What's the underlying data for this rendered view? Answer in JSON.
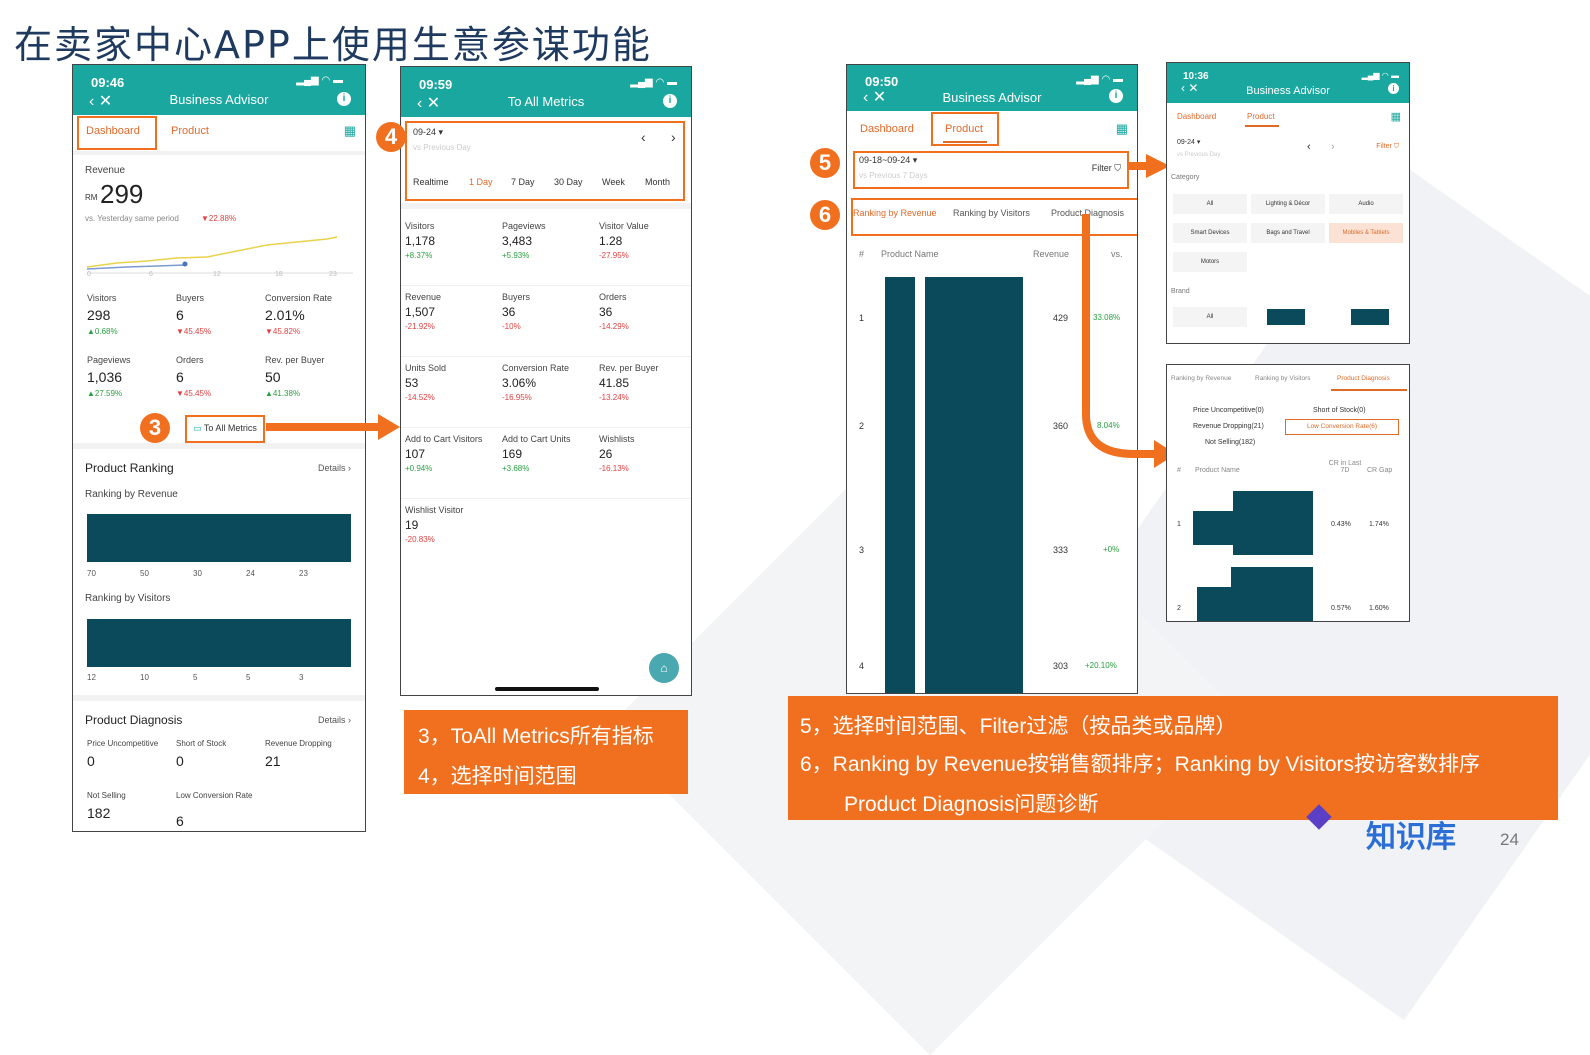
{
  "title": "在卖家中心APP上使用生意参谋功能",
  "page_number": "24",
  "brand": "知识库",
  "p1": {
    "time": "09:46",
    "title": "Business Advisor",
    "tab_dashboard": "Dashboard",
    "tab_product": "Product",
    "revenue_label": "Revenue",
    "currency": "RM",
    "revenue": "299",
    "compare": "vs. Yesterday same period",
    "compare_pct": "▼22.88%",
    "xticks": [
      "0",
      "6",
      "12",
      "18",
      "23"
    ],
    "metrics": [
      {
        "label": "Visitors",
        "value": "298",
        "pct": "▲0.68%",
        "up": true
      },
      {
        "label": "Buyers",
        "value": "6",
        "pct": "▼45.45%",
        "up": false
      },
      {
        "label": "Conversion Rate",
        "value": "2.01%",
        "pct": "▼45.82%",
        "up": false
      },
      {
        "label": "Pageviews",
        "value": "1,036",
        "pct": "▲27.59%",
        "up": true
      },
      {
        "label": "Orders",
        "value": "6",
        "pct": "▼45.45%",
        "up": false
      },
      {
        "label": "Rev. per Buyer",
        "value": "50",
        "pct": "▲41.38%",
        "up": true
      }
    ],
    "to_all": "To All Metrics",
    "product_ranking": "Product Ranking",
    "details": "Details ›",
    "rank_revenue": "Ranking by Revenue",
    "rev_nums": [
      "70",
      "50",
      "30",
      "24",
      "23"
    ],
    "rank_visitors": "Ranking by Visitors",
    "vis_nums": [
      "12",
      "10",
      "5",
      "5",
      "3"
    ],
    "diag_title": "Product Diagnosis",
    "diag": [
      {
        "label": "Price Uncompetitive",
        "value": "0"
      },
      {
        "label": "Short of Stock",
        "value": "0"
      },
      {
        "label": "Revenue Dropping",
        "value": "21"
      },
      {
        "label": "Not Selling",
        "value": "182"
      },
      {
        "label": "Low Conversion Rate",
        "value": "6"
      }
    ]
  },
  "p2": {
    "time": "09:59",
    "title": "To All Metrics",
    "date": "09-24 ▾",
    "prev": "vs Previous Day",
    "ranges": [
      "Realtime",
      "1 Day",
      "7 Day",
      "30 Day",
      "Week",
      "Month"
    ],
    "metrics": [
      {
        "label": "Visitors",
        "value": "1,178",
        "pct": "+8.37%",
        "up": true
      },
      {
        "label": "Pageviews",
        "value": "3,483",
        "pct": "+5.93%",
        "up": true
      },
      {
        "label": "Visitor Value",
        "value": "1.28",
        "pct": "-27.95%",
        "up": false
      },
      {
        "label": "Revenue",
        "value": "1,507",
        "pct": "-21.92%",
        "up": false
      },
      {
        "label": "Buyers",
        "value": "36",
        "pct": "-10%",
        "up": false
      },
      {
        "label": "Orders",
        "value": "36",
        "pct": "-14.29%",
        "up": false
      },
      {
        "label": "Units Sold",
        "value": "53",
        "pct": "-14.52%",
        "up": false
      },
      {
        "label": "Conversion Rate",
        "value": "3.06%",
        "pct": "-16.95%",
        "up": false
      },
      {
        "label": "Rev. per Buyer",
        "value": "41.85",
        "pct": "-13.24%",
        "up": false
      },
      {
        "label": "Add to Cart Visitors",
        "value": "107",
        "pct": "+0.94%",
        "up": true
      },
      {
        "label": "Add to Cart Units",
        "value": "169",
        "pct": "+3.68%",
        "up": true
      },
      {
        "label": "Wishlists",
        "value": "26",
        "pct": "-16.13%",
        "up": false
      },
      {
        "label": "Wishlist Visitor",
        "value": "19",
        "pct": "-20.83%",
        "up": false
      }
    ]
  },
  "p3": {
    "time": "09:50",
    "title": "Business Advisor",
    "tab_dashboard": "Dashboard",
    "tab_product": "Product",
    "date": "09-18~09-24 ▾",
    "prev": "vs Previous 7 Days",
    "filter": "Filter",
    "rtabs": [
      "Ranking by Revenue",
      "Ranking by Visitors",
      "Product Diagnosis"
    ],
    "cols": [
      "#",
      "Product Name",
      "Revenue",
      "vs."
    ],
    "rows": [
      {
        "n": "1",
        "rev": "429",
        "vs": "33.08%"
      },
      {
        "n": "2",
        "rev": "360",
        "vs": "8.04%"
      },
      {
        "n": "3",
        "rev": "333",
        "vs": "+0%"
      },
      {
        "n": "4",
        "rev": "303",
        "vs": "+20.10%"
      }
    ]
  },
  "p4": {
    "time": "10:36",
    "title": "Business Advisor",
    "tab_dashboard": "Dashboard",
    "tab_product": "Product",
    "date": "09-24 ▾",
    "prev": "vs Previous Day",
    "filter": "Filter",
    "category": "Category",
    "cats": [
      "All",
      "Lighting & Décor",
      "Audio",
      "Smart Devices",
      "Bags and Travel",
      "Mobiles & Tablets",
      "Motors"
    ],
    "brand": "Brand",
    "brand_all": "All"
  },
  "p5": {
    "rtabs": [
      "Ranking by Revenue",
      "Ranking by Visitors",
      "Product Diagnosis"
    ],
    "opts": [
      "Price Uncompetitive(0)",
      "Short of Stock(0)",
      "Revenue Dropping(21)",
      "Low Conversion Rate(6)",
      "Not Selling(182)"
    ],
    "cols": [
      "#",
      "Product Name",
      "CR in Last 7D",
      "CR Gap"
    ],
    "rows": [
      {
        "n": "1",
        "cr": "0.43%",
        "gap": "1.74%"
      },
      {
        "n": "2",
        "cr": "0.57%",
        "gap": "1.60%"
      }
    ]
  },
  "markers": [
    "3",
    "4",
    "5",
    "6"
  ],
  "callout1": [
    "3，ToAll Metrics所有指标",
    "4，选择时间范围"
  ],
  "callout2": [
    "5，选择时间范围、Filter过滤（按品类或品牌）",
    "6，Ranking by Revenue按销售额排序；Ranking by Visitors按访客数排序",
    "Product Diagnosis问题诊断"
  ]
}
